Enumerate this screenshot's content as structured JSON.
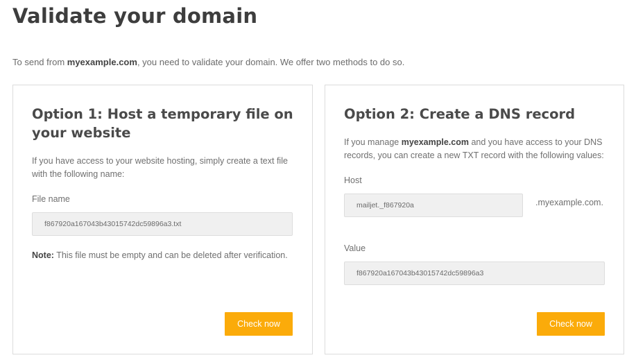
{
  "page": {
    "title": "Validate your domain",
    "intro_before": "To send from ",
    "intro_domain": "myexample.com",
    "intro_after": ", you need to validate your domain. We offer two methods to do so."
  },
  "option1": {
    "title": "Option 1: Host a temporary file on your website",
    "description": "If you have access to your website hosting, simply create a text file with the following name:",
    "file_label": "File name",
    "file_value": "f867920a167043b43015742dc59896a3.txt",
    "note_label": "Note:",
    "note_text": " This file must be empty and can be deleted after verification.",
    "button_label": "Check now"
  },
  "option2": {
    "title": "Option 2: Create a DNS record",
    "desc_before": "If you manage ",
    "desc_domain": "myexample.com",
    "desc_after": " and you have access to your DNS records, you can create a new TXT record with the following values:",
    "host_label": "Host",
    "host_value": "mailjet._f867920a",
    "host_suffix": ".myexample.com.",
    "value_label": "Value",
    "value_value": "f867920a167043b43015742dc59896a3",
    "button_label": "Check now"
  },
  "colors": {
    "accent": "#fbab0a",
    "border": "#dcdcdc",
    "field_bg": "#f0f0f0"
  }
}
